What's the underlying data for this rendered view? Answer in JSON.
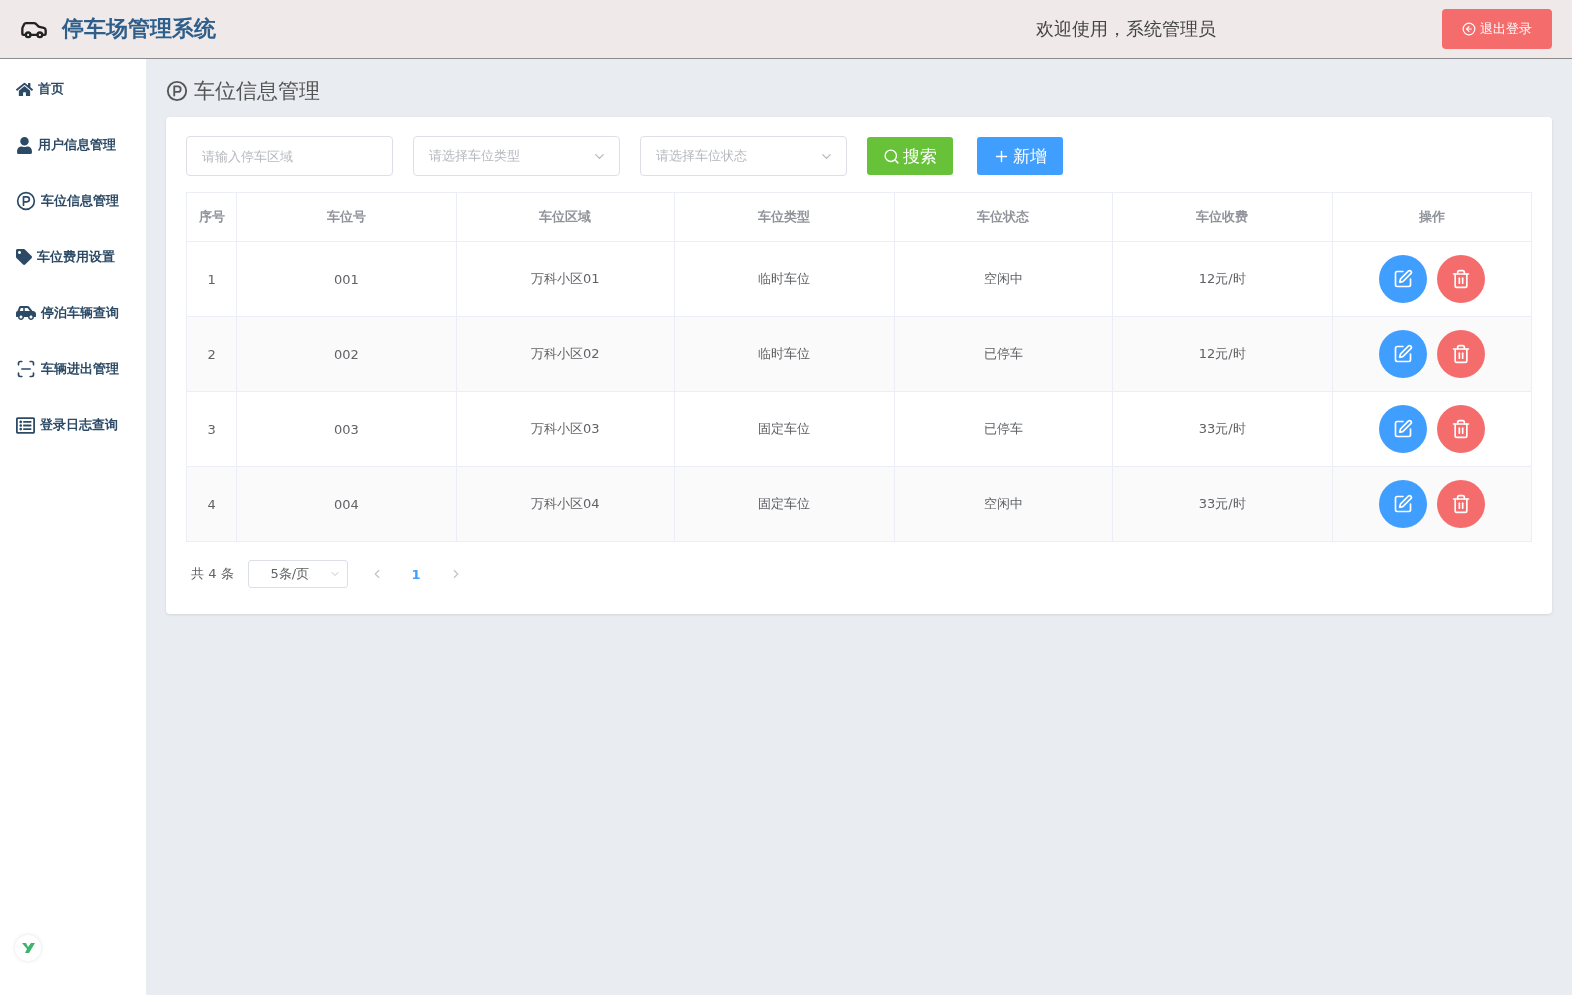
{
  "header": {
    "title": "停车场管理系统",
    "welcome": "欢迎使用，系统管理员",
    "logout": "退出登录"
  },
  "sidebar": {
    "items": [
      {
        "label": "首页",
        "kind": "home"
      },
      {
        "label": "用户信息管理",
        "kind": "user"
      },
      {
        "label": "车位信息管理",
        "kind": "parking"
      },
      {
        "label": "车位费用设置",
        "kind": "tag"
      },
      {
        "label": "停泊车辆查询",
        "kind": "car"
      },
      {
        "label": "车辆进出管理",
        "kind": "scan"
      },
      {
        "label": "登录日志查询",
        "kind": "log"
      }
    ]
  },
  "page_title": "车位信息管理",
  "filters": {
    "area": {
      "placeholder": "请输入停车区域"
    },
    "type": {
      "placeholder": "请选择车位类型"
    },
    "status": {
      "placeholder": "请选择车位状态"
    },
    "search_button": "搜索",
    "add_button": "新增"
  },
  "table": {
    "columns": [
      "序号",
      "车位号",
      "车位区域",
      "车位类型",
      "车位状态",
      "车位收费",
      "操作"
    ],
    "rows": [
      [
        "1",
        "001",
        "万科小区01",
        "临时车位",
        "空闲中",
        "12元/时"
      ],
      [
        "2",
        "002",
        "万科小区02",
        "临时车位",
        "已停车",
        "12元/时"
      ],
      [
        "3",
        "003",
        "万科小区03",
        "固定车位",
        "已停车",
        "33元/时"
      ],
      [
        "4",
        "004",
        "万科小区04",
        "固定车位",
        "空闲中",
        "33元/时"
      ]
    ]
  },
  "pagination": {
    "total": "共 4 条",
    "page_size": "5条/页",
    "pages": [
      {
        "label": "1",
        "selected": true
      }
    ]
  }
}
